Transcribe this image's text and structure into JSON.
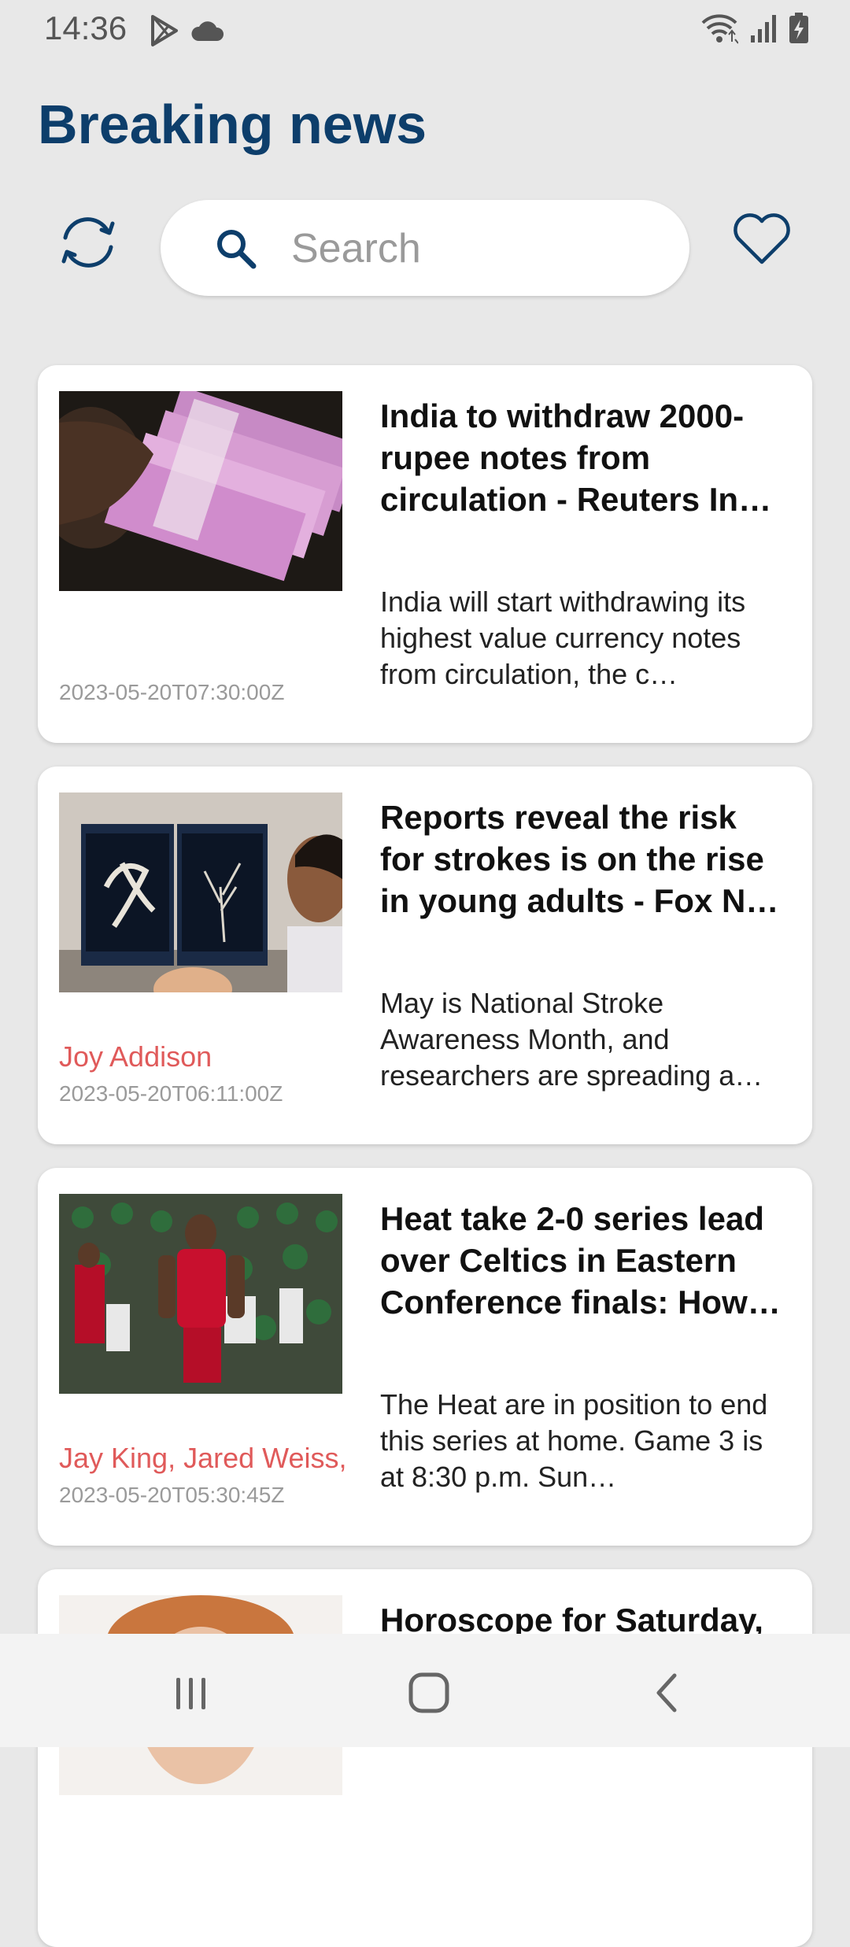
{
  "status_bar": {
    "time": "14:36",
    "left_icons": [
      "play-store-icon",
      "cloud-icon"
    ],
    "right_icons": [
      "wifi-icon",
      "signal-icon",
      "battery-charging-icon"
    ]
  },
  "header": {
    "title": "Breaking news"
  },
  "toolbar": {
    "refresh_icon": "refresh-icon",
    "search_placeholder": "Search",
    "search_value": "",
    "favorites_icon": "heart-icon"
  },
  "colors": {
    "brand": "#0d3e6b",
    "author": "#e05a5a",
    "date": "#9a9a9a",
    "background": "#e8e8e8"
  },
  "articles": [
    {
      "title": "India to withdraw 2000-rupee notes from circulation - Reuters In…",
      "description": "India will start withdrawing its highest value currency notes from circulation, the c…",
      "author": "",
      "date": "2023-05-20T07:30:00Z",
      "image": "rupee-notes-image"
    },
    {
      "title": "Reports reveal the risk for strokes is on the rise in young adults - Fox N…",
      "description": "May is National Stroke Awareness Month, and researchers are spreading a…",
      "author": "Joy Addison",
      "date": "2023-05-20T06:11:00Z",
      "image": "brain-scan-image"
    },
    {
      "title": "Heat take 2-0 series lead over Celtics in Eastern Conference finals: How …",
      "description": "The Heat are in position to end this series at home. Game 3 is at 8:30 p.m. Sun…",
      "author": "Jay King, Jared Weiss,",
      "date": "2023-05-20T05:30:45Z",
      "image": "basketball-image"
    },
    {
      "title": "Horoscope for Saturday,",
      "description": "",
      "author": "",
      "date": "",
      "image": "portrait-image"
    }
  ],
  "nav_bar": {
    "items": [
      "recents-icon",
      "home-icon",
      "back-icon"
    ]
  }
}
